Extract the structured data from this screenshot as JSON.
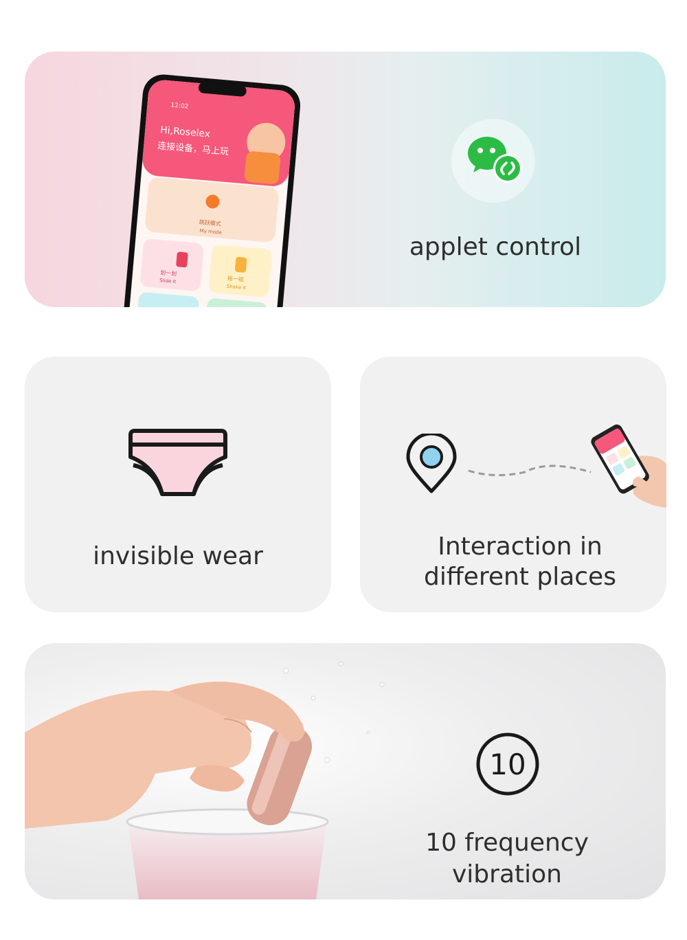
{
  "features": {
    "applet": {
      "label": "applet control",
      "icon": "wechat-miniprogram-icon"
    },
    "wear": {
      "label": "invisible wear",
      "icon": "underwear-icon"
    },
    "interaction": {
      "label_line1": "Interaction in",
      "label_line2": "different places",
      "icon": "location-pin-icon"
    },
    "vibration": {
      "label": "10 frequency vibration",
      "badge": "10"
    }
  },
  "phone_screen": {
    "time": "12:02",
    "greeting": "Hi,Roselex",
    "subtitle": "连接设备，马上玩",
    "tile_1_cn": "跳跃模式",
    "tile_1_en": "My mode",
    "tile_2_cn": "划一划",
    "tile_2_en": "Slide it",
    "tile_3_cn": "摇一摇",
    "tile_3_en": "Shake it"
  },
  "colors": {
    "wechat_green": "#2cbc45",
    "pink": "#f0507a",
    "location_blue": "#8fd3ef"
  }
}
